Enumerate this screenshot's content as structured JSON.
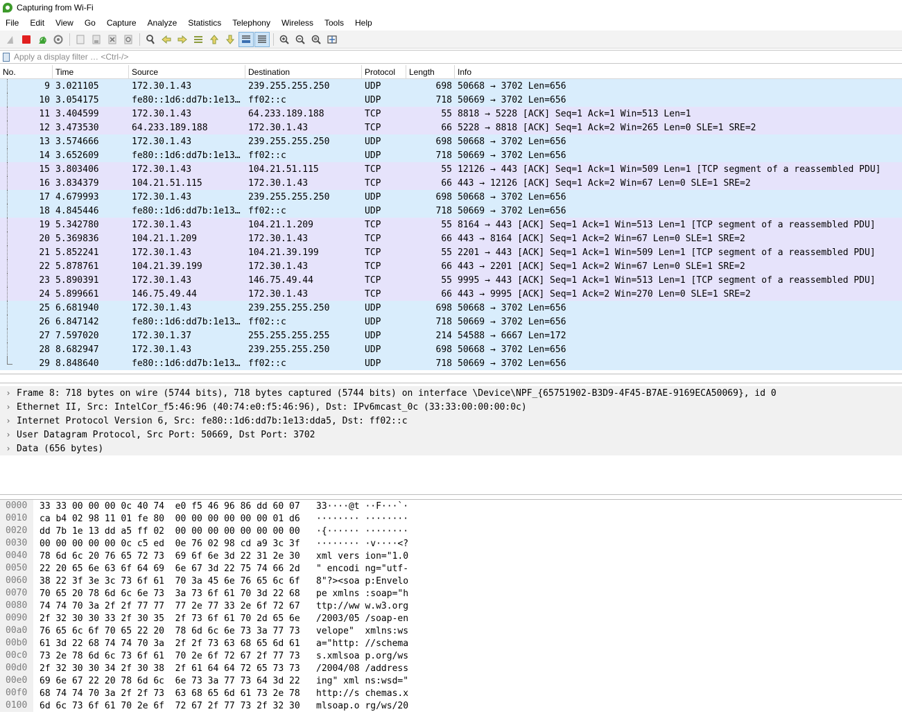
{
  "window": {
    "title": "Capturing from Wi-Fi"
  },
  "menu": [
    "File",
    "Edit",
    "View",
    "Go",
    "Capture",
    "Analyze",
    "Statistics",
    "Telephony",
    "Wireless",
    "Tools",
    "Help"
  ],
  "toolbar": {
    "icons": [
      "shark-fin-start-icon",
      "stop-capture-icon",
      "restart-capture-icon",
      "capture-options-icon",
      "open-file-icon",
      "save-file-icon",
      "close-file-icon",
      "reload-file-icon",
      "find-packet-icon",
      "go-back-icon",
      "go-forward-icon",
      "go-to-packet-icon",
      "first-packet-icon",
      "last-packet-icon",
      "autoscroll-icon",
      "colorize-icon",
      "zoom-in-icon",
      "zoom-out-icon",
      "zoom-normal-icon",
      "resize-columns-icon"
    ]
  },
  "filter": {
    "placeholder": "Apply a display filter … <Ctrl-/>"
  },
  "packet_list": {
    "columns": [
      "No.",
      "Time",
      "Source",
      "Destination",
      "Protocol",
      "Length",
      "Info"
    ],
    "rows": [
      {
        "no": "9",
        "time": "3.021105",
        "src": "172.30.1.43",
        "dst": "239.255.255.250",
        "proto": "UDP",
        "len": "698",
        "info": "50668 → 3702 Len=656"
      },
      {
        "no": "10",
        "time": "3.054175",
        "src": "fe80::1d6:dd7b:1e13…",
        "dst": "ff02::c",
        "proto": "UDP",
        "len": "718",
        "info": "50669 → 3702 Len=656"
      },
      {
        "no": "11",
        "time": "3.404599",
        "src": "172.30.1.43",
        "dst": "64.233.189.188",
        "proto": "TCP",
        "len": "55",
        "info": "8818 → 5228 [ACK] Seq=1 Ack=1 Win=513 Len=1"
      },
      {
        "no": "12",
        "time": "3.473530",
        "src": "64.233.189.188",
        "dst": "172.30.1.43",
        "proto": "TCP",
        "len": "66",
        "info": "5228 → 8818 [ACK] Seq=1 Ack=2 Win=265 Len=0 SLE=1 SRE=2"
      },
      {
        "no": "13",
        "time": "3.574666",
        "src": "172.30.1.43",
        "dst": "239.255.255.250",
        "proto": "UDP",
        "len": "698",
        "info": "50668 → 3702 Len=656"
      },
      {
        "no": "14",
        "time": "3.652609",
        "src": "fe80::1d6:dd7b:1e13…",
        "dst": "ff02::c",
        "proto": "UDP",
        "len": "718",
        "info": "50669 → 3702 Len=656"
      },
      {
        "no": "15",
        "time": "3.803406",
        "src": "172.30.1.43",
        "dst": "104.21.51.115",
        "proto": "TCP",
        "len": "55",
        "info": "12126 → 443 [ACK] Seq=1 Ack=1 Win=509 Len=1 [TCP segment of a reassembled PDU]"
      },
      {
        "no": "16",
        "time": "3.834379",
        "src": "104.21.51.115",
        "dst": "172.30.1.43",
        "proto": "TCP",
        "len": "66",
        "info": "443 → 12126 [ACK] Seq=1 Ack=2 Win=67 Len=0 SLE=1 SRE=2"
      },
      {
        "no": "17",
        "time": "4.679993",
        "src": "172.30.1.43",
        "dst": "239.255.255.250",
        "proto": "UDP",
        "len": "698",
        "info": "50668 → 3702 Len=656"
      },
      {
        "no": "18",
        "time": "4.845446",
        "src": "fe80::1d6:dd7b:1e13…",
        "dst": "ff02::c",
        "proto": "UDP",
        "len": "718",
        "info": "50669 → 3702 Len=656"
      },
      {
        "no": "19",
        "time": "5.342780",
        "src": "172.30.1.43",
        "dst": "104.21.1.209",
        "proto": "TCP",
        "len": "55",
        "info": "8164 → 443 [ACK] Seq=1 Ack=1 Win=513 Len=1 [TCP segment of a reassembled PDU]"
      },
      {
        "no": "20",
        "time": "5.369836",
        "src": "104.21.1.209",
        "dst": "172.30.1.43",
        "proto": "TCP",
        "len": "66",
        "info": "443 → 8164 [ACK] Seq=1 Ack=2 Win=67 Len=0 SLE=1 SRE=2"
      },
      {
        "no": "21",
        "time": "5.852241",
        "src": "172.30.1.43",
        "dst": "104.21.39.199",
        "proto": "TCP",
        "len": "55",
        "info": "2201 → 443 [ACK] Seq=1 Ack=1 Win=509 Len=1 [TCP segment of a reassembled PDU]"
      },
      {
        "no": "22",
        "time": "5.878761",
        "src": "104.21.39.199",
        "dst": "172.30.1.43",
        "proto": "TCP",
        "len": "66",
        "info": "443 → 2201 [ACK] Seq=1 Ack=2 Win=67 Len=0 SLE=1 SRE=2"
      },
      {
        "no": "23",
        "time": "5.890391",
        "src": "172.30.1.43",
        "dst": "146.75.49.44",
        "proto": "TCP",
        "len": "55",
        "info": "9995 → 443 [ACK] Seq=1 Ack=1 Win=513 Len=1 [TCP segment of a reassembled PDU]"
      },
      {
        "no": "24",
        "time": "5.899661",
        "src": "146.75.49.44",
        "dst": "172.30.1.43",
        "proto": "TCP",
        "len": "66",
        "info": "443 → 9995 [ACK] Seq=1 Ack=2 Win=270 Len=0 SLE=1 SRE=2"
      },
      {
        "no": "25",
        "time": "6.681940",
        "src": "172.30.1.43",
        "dst": "239.255.255.250",
        "proto": "UDP",
        "len": "698",
        "info": "50668 → 3702 Len=656"
      },
      {
        "no": "26",
        "time": "6.847142",
        "src": "fe80::1d6:dd7b:1e13…",
        "dst": "ff02::c",
        "proto": "UDP",
        "len": "718",
        "info": "50669 → 3702 Len=656"
      },
      {
        "no": "27",
        "time": "7.597020",
        "src": "172.30.1.37",
        "dst": "255.255.255.255",
        "proto": "UDP",
        "len": "214",
        "info": "54588 → 6667 Len=172"
      },
      {
        "no": "28",
        "time": "8.682947",
        "src": "172.30.1.43",
        "dst": "239.255.255.250",
        "proto": "UDP",
        "len": "698",
        "info": "50668 → 3702 Len=656"
      },
      {
        "no": "29",
        "time": "8.848640",
        "src": "fe80::1d6:dd7b:1e13…",
        "dst": "ff02::c",
        "proto": "UDP",
        "len": "718",
        "info": "50669 → 3702 Len=656"
      }
    ]
  },
  "details": [
    "Frame 8: 718 bytes on wire (5744 bits), 718 bytes captured (5744 bits) on interface \\Device\\NPF_{65751902-B3D9-4F45-B7AE-9169ECA50069}, id 0",
    "Ethernet II, Src: IntelCor_f5:46:96 (40:74:e0:f5:46:96), Dst: IPv6mcast_0c (33:33:00:00:00:0c)",
    "Internet Protocol Version 6, Src: fe80::1d6:dd7b:1e13:dda5, Dst: ff02::c",
    "User Datagram Protocol, Src Port: 50669, Dst Port: 3702",
    "Data (656 bytes)"
  ],
  "bytes": [
    {
      "off": "0000",
      "hex": "33 33 00 00 00 0c 40 74  e0 f5 46 96 86 dd 60 07",
      "ascii": "33····@t ··F···`·"
    },
    {
      "off": "0010",
      "hex": "ca b4 02 98 11 01 fe 80  00 00 00 00 00 00 01 d6",
      "ascii": "········ ········"
    },
    {
      "off": "0020",
      "hex": "dd 7b 1e 13 dd a5 ff 02  00 00 00 00 00 00 00 00",
      "ascii": "·{······ ········"
    },
    {
      "off": "0030",
      "hex": "00 00 00 00 00 0c c5 ed  0e 76 02 98 cd a9 3c 3f",
      "ascii": "········ ·v····<?"
    },
    {
      "off": "0040",
      "hex": "78 6d 6c 20 76 65 72 73  69 6f 6e 3d 22 31 2e 30",
      "ascii": "xml vers ion=\"1.0"
    },
    {
      "off": "0050",
      "hex": "22 20 65 6e 63 6f 64 69  6e 67 3d 22 75 74 66 2d",
      "ascii": "\" encodi ng=\"utf-"
    },
    {
      "off": "0060",
      "hex": "38 22 3f 3e 3c 73 6f 61  70 3a 45 6e 76 65 6c 6f",
      "ascii": "8\"?><soa p:Envelo"
    },
    {
      "off": "0070",
      "hex": "70 65 20 78 6d 6c 6e 73  3a 73 6f 61 70 3d 22 68",
      "ascii": "pe xmlns :soap=\"h"
    },
    {
      "off": "0080",
      "hex": "74 74 70 3a 2f 2f 77 77  77 2e 77 33 2e 6f 72 67",
      "ascii": "ttp://ww w.w3.org"
    },
    {
      "off": "0090",
      "hex": "2f 32 30 30 33 2f 30 35  2f 73 6f 61 70 2d 65 6e",
      "ascii": "/2003/05 /soap-en"
    },
    {
      "off": "00a0",
      "hex": "76 65 6c 6f 70 65 22 20  78 6d 6c 6e 73 3a 77 73",
      "ascii": "velope\"  xmlns:ws"
    },
    {
      "off": "00b0",
      "hex": "61 3d 22 68 74 74 70 3a  2f 2f 73 63 68 65 6d 61",
      "ascii": "a=\"http: //schema"
    },
    {
      "off": "00c0",
      "hex": "73 2e 78 6d 6c 73 6f 61  70 2e 6f 72 67 2f 77 73",
      "ascii": "s.xmlsoa p.org/ws"
    },
    {
      "off": "00d0",
      "hex": "2f 32 30 30 34 2f 30 38  2f 61 64 64 72 65 73 73",
      "ascii": "/2004/08 /address"
    },
    {
      "off": "00e0",
      "hex": "69 6e 67 22 20 78 6d 6c  6e 73 3a 77 73 64 3d 22",
      "ascii": "ing\" xml ns:wsd=\""
    },
    {
      "off": "00f0",
      "hex": "68 74 74 70 3a 2f 2f 73  63 68 65 6d 61 73 2e 78",
      "ascii": "http://s chemas.x"
    },
    {
      "off": "0100",
      "hex": "6d 6c 73 6f 61 70 2e 6f  72 67 2f 77 73 2f 32 30",
      "ascii": "mlsoap.o rg/ws/20"
    }
  ],
  "colors": {
    "udp_row": "#d9edfc",
    "tcp_row": "#e6e3fb",
    "selection": "#b7daf6"
  }
}
